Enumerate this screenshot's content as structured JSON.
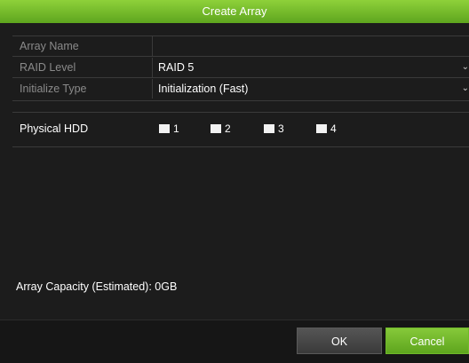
{
  "dialog": {
    "title": "Create Array"
  },
  "form": {
    "array_name": {
      "label": "Array Name",
      "value": ""
    },
    "raid_level": {
      "label": "RAID Level",
      "value": "RAID 5"
    },
    "initialize_type": {
      "label": "Initialize Type",
      "value": "Initialization (Fast)"
    }
  },
  "physical_hdd": {
    "label": "Physical HDD",
    "disks": [
      "1",
      "2",
      "3",
      "4"
    ]
  },
  "capacity": {
    "text": "Array Capacity (Estimated): 0GB"
  },
  "buttons": {
    "ok": "OK",
    "cancel": "Cancel"
  },
  "colors": {
    "accent": "#6fb82a",
    "background": "#1c1c1c"
  }
}
